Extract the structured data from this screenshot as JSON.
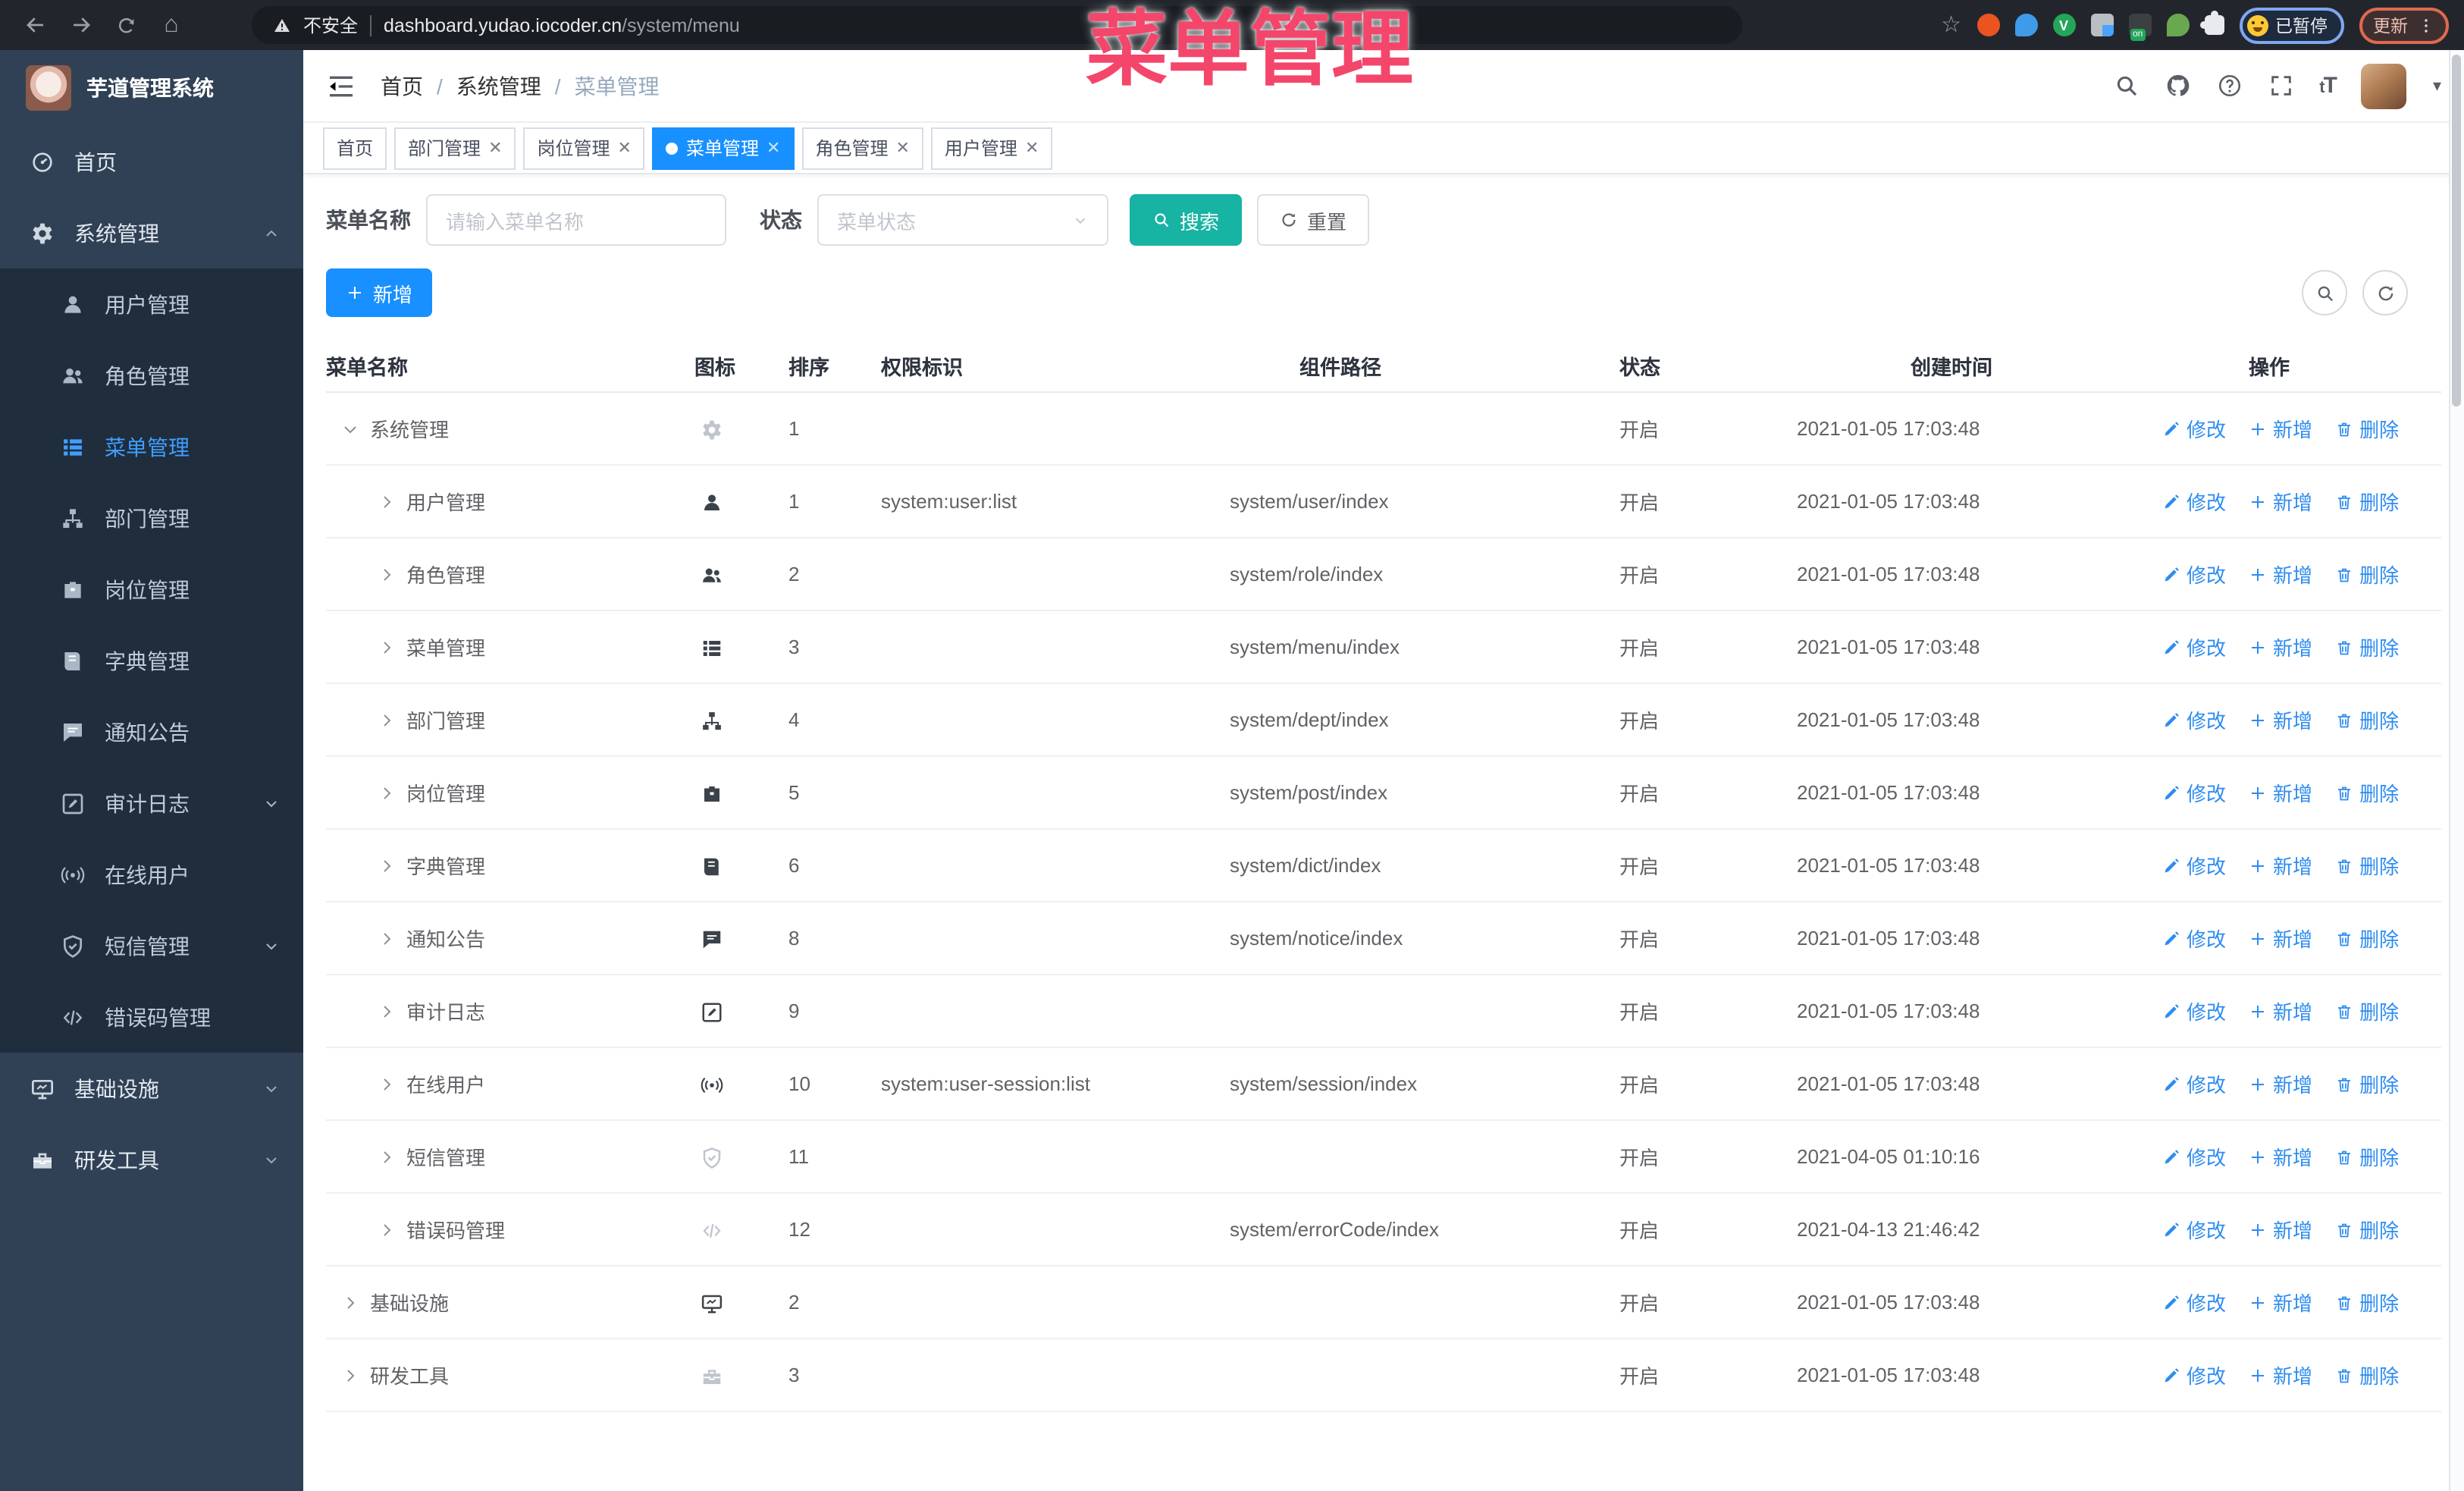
{
  "browser": {
    "security_label": "不安全",
    "url_host": "dashboard.yudao.iocoder.cn",
    "url_path": "/system/menu",
    "profile_badge": "已暂停",
    "update_button": "更新",
    "ext_v_letter": "V",
    "ext_on_badge": "on"
  },
  "overlay_title": "菜单管理",
  "sidebar": {
    "logo_title": "芋道管理系统",
    "items": [
      {
        "label": "首页",
        "icon": "dashboard"
      },
      {
        "label": "系统管理",
        "icon": "gear",
        "chevron": "up",
        "children": [
          {
            "label": "用户管理",
            "icon": "user"
          },
          {
            "label": "角色管理",
            "icon": "users"
          },
          {
            "label": "菜单管理",
            "icon": "menu",
            "active": true
          },
          {
            "label": "部门管理",
            "icon": "tree"
          },
          {
            "label": "岗位管理",
            "icon": "badge"
          },
          {
            "label": "字典管理",
            "icon": "book"
          },
          {
            "label": "通知公告",
            "icon": "message"
          },
          {
            "label": "审计日志",
            "icon": "edit",
            "chevron": "down"
          },
          {
            "label": "在线用户",
            "icon": "online"
          },
          {
            "label": "短信管理",
            "icon": "shield",
            "chevron": "down"
          },
          {
            "label": "错误码管理",
            "icon": "code"
          }
        ]
      },
      {
        "label": "基础设施",
        "icon": "monitor",
        "chevron": "down"
      },
      {
        "label": "研发工具",
        "icon": "toolbox",
        "chevron": "down"
      }
    ]
  },
  "header": {
    "breadcrumb": [
      "首页",
      "系统管理",
      "菜单管理"
    ],
    "font_icon_text": "tT"
  },
  "tabs": [
    {
      "label": "首页",
      "closable": false,
      "active": false
    },
    {
      "label": "部门管理",
      "closable": true,
      "active": false
    },
    {
      "label": "岗位管理",
      "closable": true,
      "active": false
    },
    {
      "label": "菜单管理",
      "closable": true,
      "active": true
    },
    {
      "label": "角色管理",
      "closable": true,
      "active": false
    },
    {
      "label": "用户管理",
      "closable": true,
      "active": false
    }
  ],
  "search": {
    "name_label": "菜单名称",
    "name_placeholder": "请输入菜单名称",
    "status_label": "状态",
    "status_placeholder": "菜单状态",
    "search_label": "搜索",
    "reset_label": "重置"
  },
  "toolbar": {
    "add_label": "新增"
  },
  "table": {
    "headers": [
      "菜单名称",
      "图标",
      "排序",
      "权限标识",
      "组件路径",
      "状态",
      "创建时间",
      "操作"
    ],
    "ops": [
      {
        "icon": "pen",
        "label": "修改"
      },
      {
        "icon": "plus",
        "label": "新增"
      },
      {
        "icon": "trash",
        "label": "删除"
      }
    ],
    "rows": [
      {
        "name": "系统管理",
        "icon": "gear",
        "muted": true,
        "level": 0,
        "caret": "expanded",
        "sort": "1",
        "perm": "",
        "path": "",
        "status": "开启",
        "time": "2021-01-05 17:03:48"
      },
      {
        "name": "用户管理",
        "icon": "user",
        "muted": false,
        "level": 1,
        "caret": "collapsed",
        "sort": "1",
        "perm": "system:user:list",
        "path": "system/user/index",
        "status": "开启",
        "time": "2021-01-05 17:03:48"
      },
      {
        "name": "角色管理",
        "icon": "users",
        "muted": false,
        "level": 1,
        "caret": "collapsed",
        "sort": "2",
        "perm": "",
        "path": "system/role/index",
        "status": "开启",
        "time": "2021-01-05 17:03:48"
      },
      {
        "name": "菜单管理",
        "icon": "menu",
        "muted": false,
        "level": 1,
        "caret": "collapsed",
        "sort": "3",
        "perm": "",
        "path": "system/menu/index",
        "status": "开启",
        "time": "2021-01-05 17:03:48"
      },
      {
        "name": "部门管理",
        "icon": "tree",
        "muted": false,
        "level": 1,
        "caret": "collapsed",
        "sort": "4",
        "perm": "",
        "path": "system/dept/index",
        "status": "开启",
        "time": "2021-01-05 17:03:48"
      },
      {
        "name": "岗位管理",
        "icon": "badge",
        "muted": false,
        "level": 1,
        "caret": "collapsed",
        "sort": "5",
        "perm": "",
        "path": "system/post/index",
        "status": "开启",
        "time": "2021-01-05 17:03:48"
      },
      {
        "name": "字典管理",
        "icon": "book",
        "muted": false,
        "level": 1,
        "caret": "collapsed",
        "sort": "6",
        "perm": "",
        "path": "system/dict/index",
        "status": "开启",
        "time": "2021-01-05 17:03:48"
      },
      {
        "name": "通知公告",
        "icon": "message",
        "muted": false,
        "level": 1,
        "caret": "collapsed",
        "sort": "8",
        "perm": "",
        "path": "system/notice/index",
        "status": "开启",
        "time": "2021-01-05 17:03:48"
      },
      {
        "name": "审计日志",
        "icon": "edit",
        "muted": false,
        "level": 1,
        "caret": "collapsed",
        "sort": "9",
        "perm": "",
        "path": "",
        "status": "开启",
        "time": "2021-01-05 17:03:48"
      },
      {
        "name": "在线用户",
        "icon": "online",
        "muted": false,
        "level": 1,
        "caret": "collapsed",
        "sort": "10",
        "perm": "system:user-session:list",
        "path": "system/session/index",
        "status": "开启",
        "time": "2021-01-05 17:03:48"
      },
      {
        "name": "短信管理",
        "icon": "shield",
        "muted": true,
        "level": 1,
        "caret": "collapsed",
        "sort": "11",
        "perm": "",
        "path": "",
        "status": "开启",
        "time": "2021-04-05 01:10:16"
      },
      {
        "name": "错误码管理",
        "icon": "code",
        "muted": true,
        "level": 1,
        "caret": "collapsed",
        "sort": "12",
        "perm": "",
        "path": "system/errorCode/index",
        "status": "开启",
        "time": "2021-04-13 21:46:42"
      },
      {
        "name": "基础设施",
        "icon": "monitor",
        "muted": false,
        "level": 0,
        "caret": "collapsed",
        "sort": "2",
        "perm": "",
        "path": "",
        "status": "开启",
        "time": "2021-01-05 17:03:48"
      },
      {
        "name": "研发工具",
        "icon": "toolbox",
        "muted": true,
        "level": 0,
        "caret": "collapsed",
        "sort": "3",
        "perm": "",
        "path": "",
        "status": "开启",
        "time": "2021-01-05 17:03:48"
      }
    ]
  },
  "colors": {
    "primary_blue": "#1890ff",
    "teal_search": "#17b3a3",
    "sidebar_bg": "#304156",
    "submenu_bg": "#1f2d3d",
    "overlay_pink": "#f4466b",
    "active_link": "#409eff"
  }
}
